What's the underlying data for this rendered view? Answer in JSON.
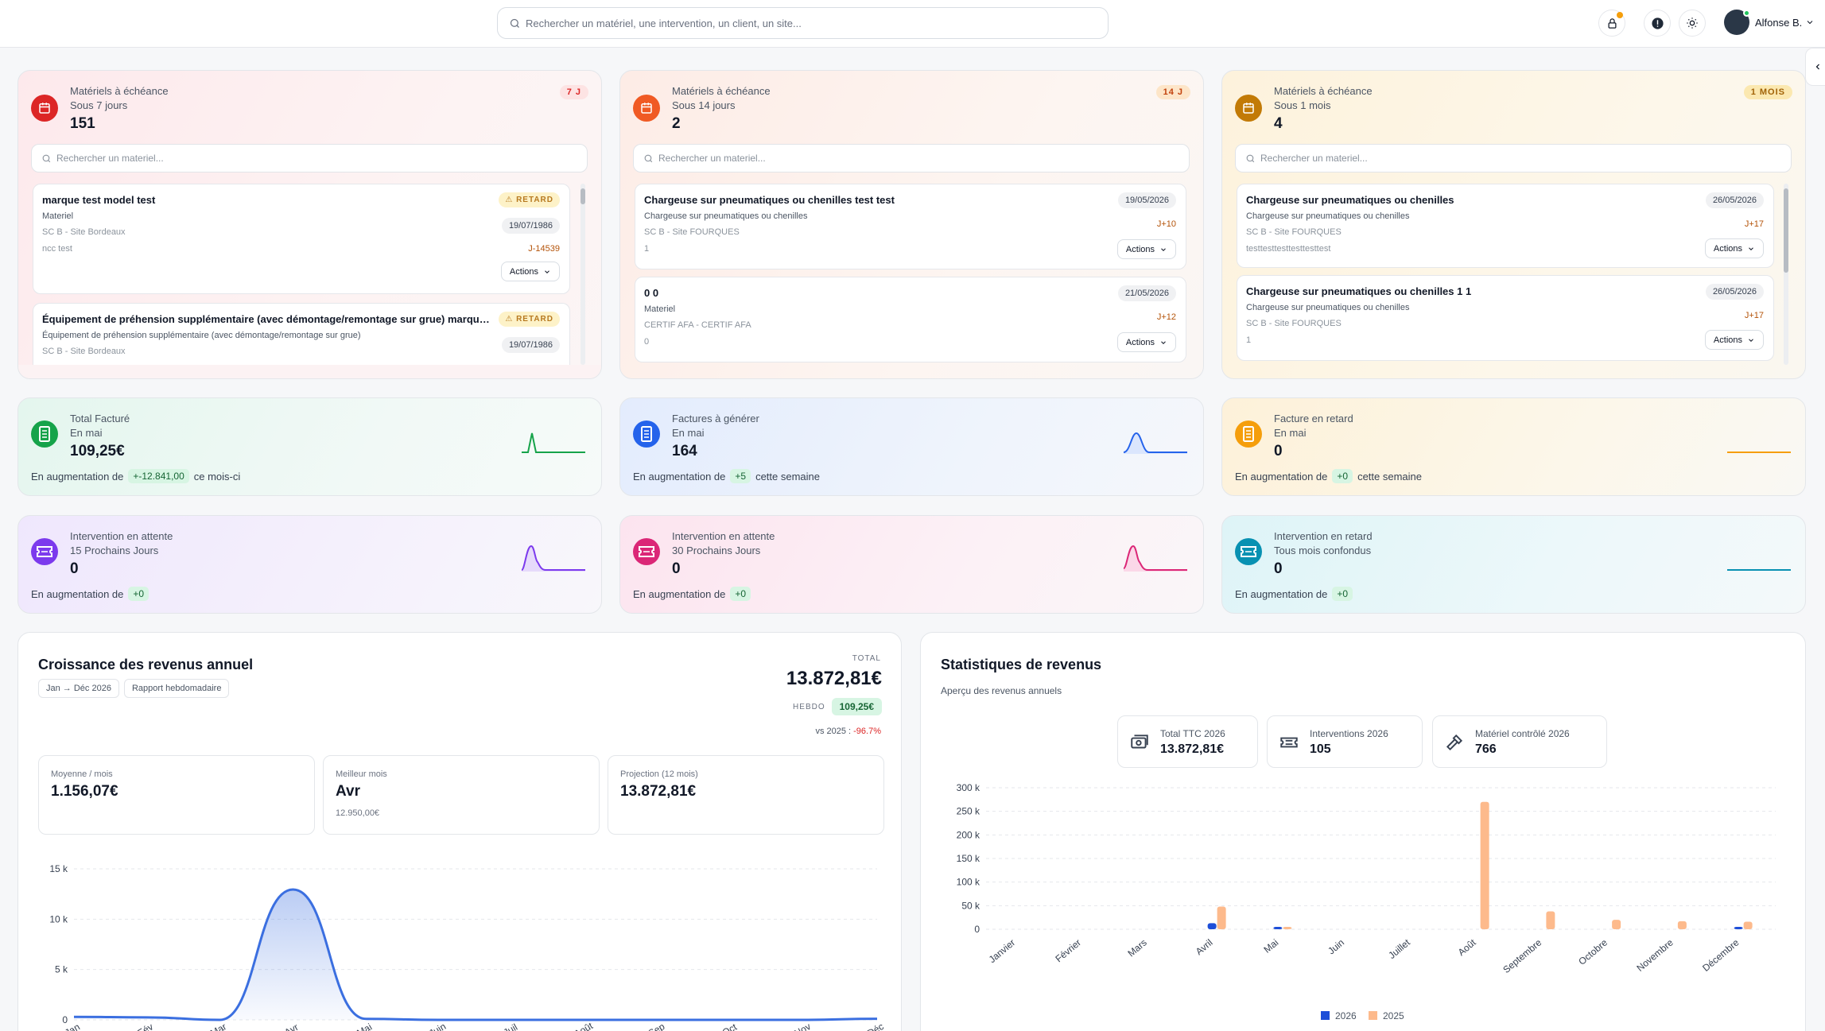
{
  "topbar": {
    "search_placeholder": "Rechercher un matériel, une intervention, un client, un site...",
    "user_name": "Alfonse B."
  },
  "echeances": [
    {
      "title": "Matériels à échéance",
      "subtitle": "Sous 7 jours",
      "count": "151",
      "badge": "7 J",
      "search_placeholder": "Rechercher un materiel...",
      "items": [
        {
          "title": "marque test model test",
          "type": "Materiel",
          "site": "SC B - Site Bordeaux",
          "extra": "ncc test",
          "date": "19/07/1986",
          "ref": "J-14539",
          "status": "RETARD",
          "action": "Actions"
        },
        {
          "title": "Équipement de préhension supplémentaire (avec démontage/remontage sur grue) marque test...",
          "type": "Équipement de préhension supplémentaire (avec démontage/remontage sur grue)",
          "site": "SC B - Site Bordeaux",
          "date": "19/07/1986",
          "status": "RETARD"
        }
      ]
    },
    {
      "title": "Matériels à échéance",
      "subtitle": "Sous 14 jours",
      "count": "2",
      "badge": "14 J",
      "search_placeholder": "Rechercher un materiel...",
      "items": [
        {
          "title": "Chargeuse sur pneumatiques ou chenilles test test",
          "type": "Chargeuse sur pneumatiques ou chenilles",
          "site": "SC B - Site FOURQUES",
          "extra": "1",
          "date": "19/05/2026",
          "ref": "J+10",
          "action": "Actions"
        },
        {
          "title": "0 0",
          "type": "Materiel",
          "site": "CERTIF AFA - CERTIF AFA",
          "extra": "0",
          "date": "21/05/2026",
          "ref": "J+12",
          "action": "Actions"
        }
      ]
    },
    {
      "title": "Matériels à échéance",
      "subtitle": "Sous 1 mois",
      "count": "4",
      "badge": "1 MOIS",
      "search_placeholder": "Rechercher un materiel...",
      "items": [
        {
          "title": "Chargeuse sur pneumatiques ou chenilles",
          "type": "Chargeuse sur pneumatiques ou chenilles",
          "site": "SC B - Site FOURQUES",
          "extra": "testtesttesttesttesttest",
          "date": "26/05/2026",
          "ref": "J+17",
          "action": "Actions"
        },
        {
          "title": "Chargeuse sur pneumatiques ou chenilles 1 1",
          "type": "Chargeuse sur pneumatiques ou chenilles",
          "site": "SC B - Site FOURQUES",
          "extra": "1",
          "date": "26/05/2026",
          "ref": "J+17",
          "action": "Actions"
        }
      ]
    }
  ],
  "kpis": [
    {
      "title": "Total Facturé",
      "subtitle": "En mai",
      "value": "109,25€",
      "prefix": "En augmentation de",
      "delta": "+-12.841,00",
      "suffix": "ce mois-ci",
      "color": "#16a34a",
      "icon": "invoice-icon"
    },
    {
      "title": "Factures à générer",
      "subtitle": "En mai",
      "value": "164",
      "prefix": "En augmentation de",
      "delta": "+5",
      "suffix": "cette semaine",
      "color": "#2563eb",
      "icon": "invoice-icon"
    },
    {
      "title": "Facture en retard",
      "subtitle": "En mai",
      "value": "0",
      "prefix": "En augmentation de",
      "delta": "+0",
      "suffix": "cette semaine",
      "color": "#f59e0b",
      "icon": "invoice-icon"
    },
    {
      "title": "Intervention en attente",
      "subtitle": "15 Prochains Jours",
      "value": "0",
      "prefix": "En augmentation de",
      "delta": "+0",
      "suffix": "",
      "color": "#7c3aed",
      "icon": "ticket-icon"
    },
    {
      "title": "Intervention en attente",
      "subtitle": "30 Prochains Jours",
      "value": "0",
      "prefix": "En augmentation de",
      "delta": "+0",
      "suffix": "",
      "color": "#db2777",
      "icon": "ticket-icon"
    },
    {
      "title": "Intervention en retard",
      "subtitle": "Tous mois confondus",
      "value": "0",
      "prefix": "En augmentation de",
      "delta": "+0",
      "suffix": "",
      "color": "#0891b2",
      "icon": "ticket-icon"
    }
  ],
  "growth": {
    "title": "Croissance des revenus annuel",
    "chip_period": "Jan → Déc 2026",
    "chip_report": "Rapport hebdomadaire",
    "total_label": "TOTAL",
    "total_value": "13.872,81€",
    "hebdo_label": "HEBDO",
    "hebdo_value": "109,25€",
    "vs_label": "vs 2025 :",
    "vs_value": "-96.7%",
    "minis": [
      {
        "label": "Moyenne / mois",
        "value": "1.156,07€",
        "sub": ""
      },
      {
        "label": "Meilleur mois",
        "value": "Avr",
        "sub": "12.950,00€"
      },
      {
        "label": "Projection (12 mois)",
        "value": "13.872,81€",
        "sub": ""
      }
    ]
  },
  "stats": {
    "title": "Statistiques de revenus",
    "subtitle": "Aperçu des revenus annuels",
    "cards": [
      {
        "label": "Total TTC 2026",
        "value": "13.872,81€",
        "icon": "cash-icon"
      },
      {
        "label": "Interventions 2026",
        "value": "105",
        "icon": "ticket-icon"
      },
      {
        "label": "Matériel contrôlé 2026",
        "value": "766",
        "icon": "hammer-icon"
      }
    ]
  },
  "chart_data": [
    {
      "type": "area",
      "categories": [
        "Jan",
        "Fév",
        "Mar",
        "Avr",
        "Mai",
        "Juin",
        "Juil",
        "Août",
        "Sep",
        "Oct",
        "Nov",
        "Déc"
      ],
      "values": [
        300,
        250,
        0,
        12950,
        100,
        0,
        0,
        0,
        0,
        0,
        0,
        109.25
      ],
      "yticks": [
        "0",
        "5 k",
        "10 k",
        "15 k"
      ],
      "ylim": [
        0,
        15000
      ],
      "grid": true,
      "color": "#3b6fe0"
    },
    {
      "type": "bar",
      "categories": [
        "Janvier",
        "Février",
        "Mars",
        "Avril",
        "Mai",
        "Juin",
        "Juillet",
        "Août",
        "Septembre",
        "Octobre",
        "Novembre",
        "Décembre"
      ],
      "series": [
        {
          "name": "2026",
          "values": [
            0,
            0,
            0,
            12950,
            800,
            0,
            0,
            0,
            0,
            0,
            0,
            109
          ],
          "color": "#1d4ed8"
        },
        {
          "name": "2025",
          "values": [
            0,
            0,
            0,
            48000,
            2000,
            0,
            0,
            270000,
            38000,
            20000,
            17000,
            16000
          ],
          "color": "#fdba8c"
        }
      ],
      "yticks": [
        "0",
        "50 k",
        "100 k",
        "150 k",
        "200 k",
        "250 k",
        "300 k"
      ],
      "ylim": [
        0,
        300000
      ],
      "grid": true,
      "legend": "bottom"
    }
  ]
}
